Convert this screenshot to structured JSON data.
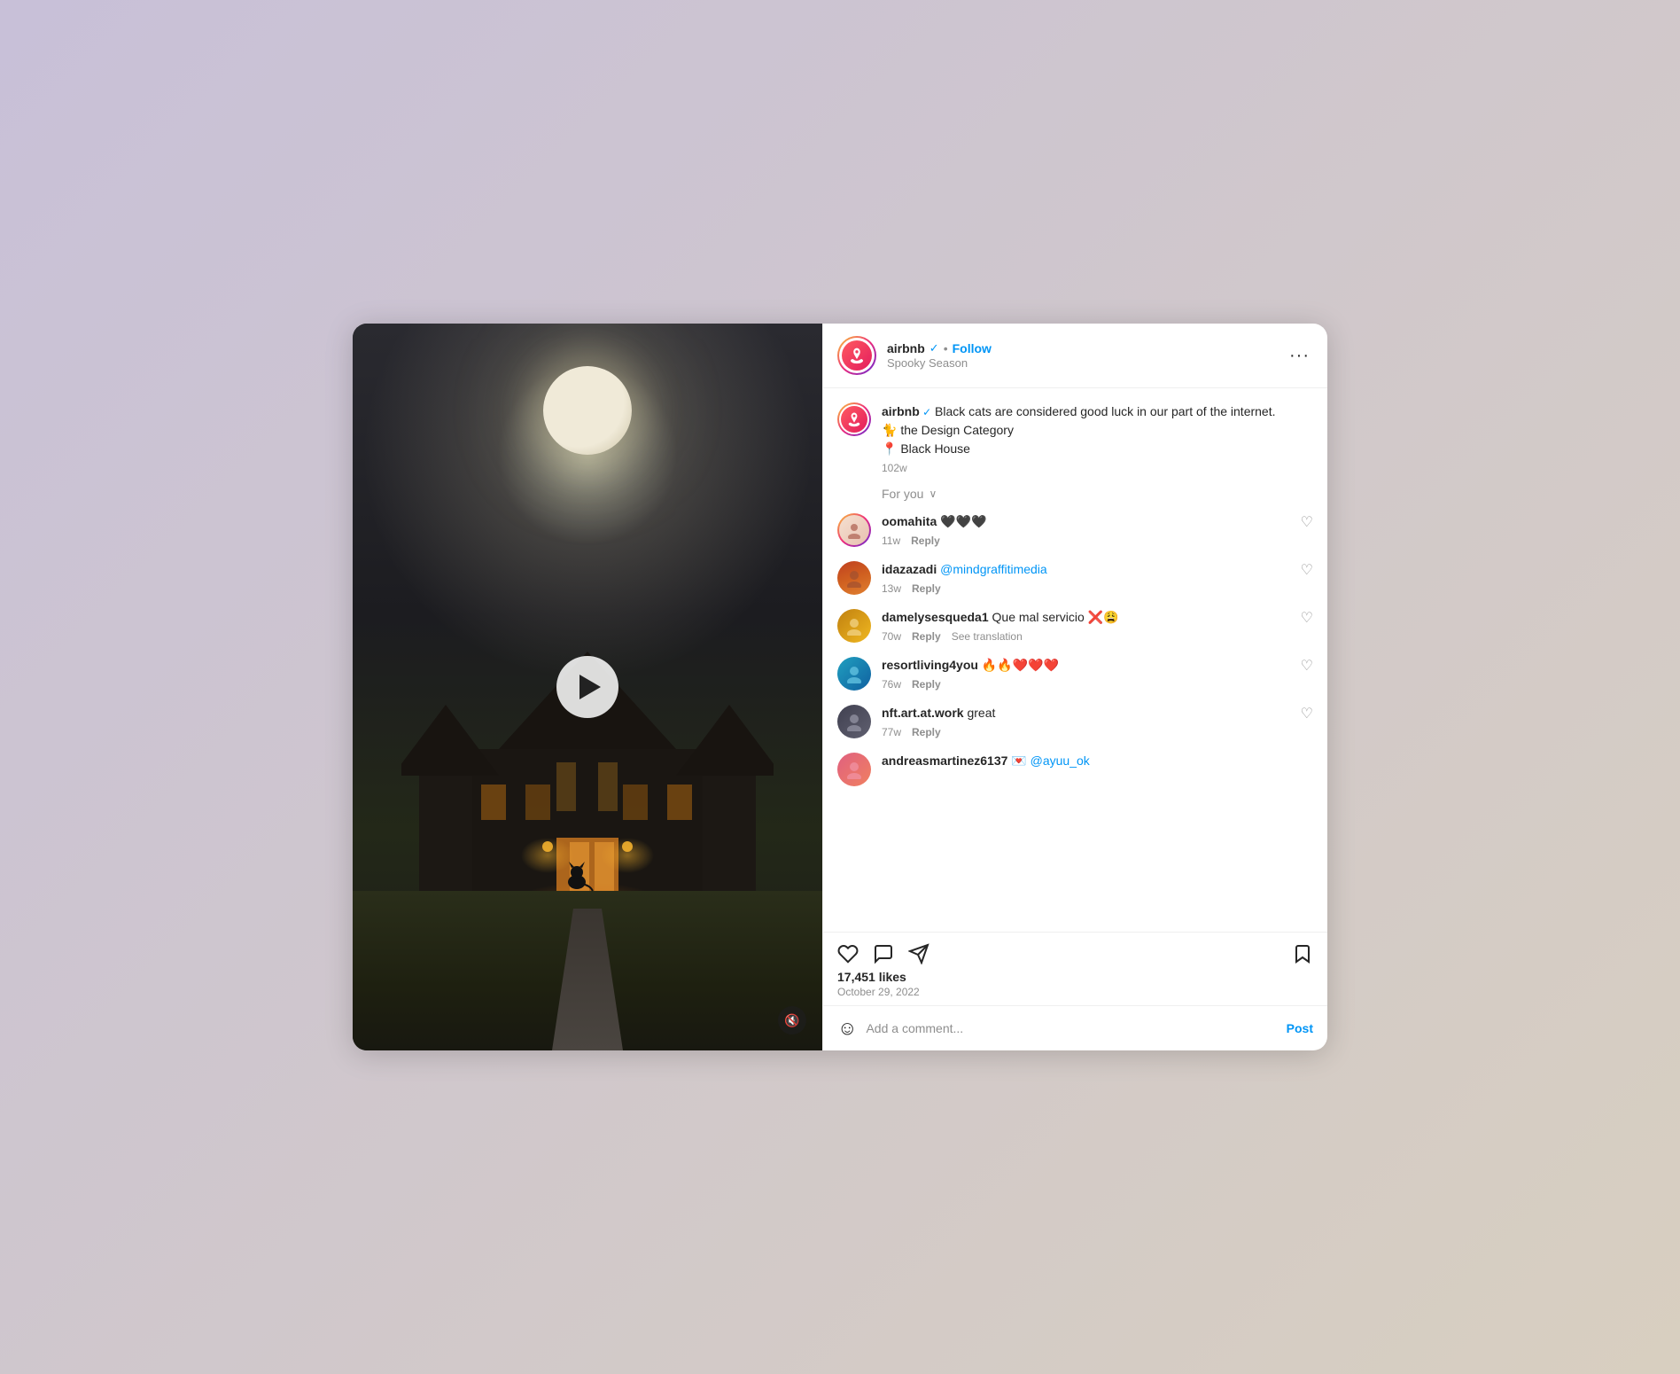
{
  "header": {
    "username": "airbnb",
    "verified": true,
    "verified_label": "✓",
    "dot": "•",
    "follow_label": "Follow",
    "subtitle": "Spooky Season",
    "more_icon": "•••"
  },
  "caption": {
    "username": "airbnb",
    "verified_label": "✓",
    "text": " Black cats are considered good luck in our part of the internet.",
    "line2": "🐈 the Design Category",
    "line3": "📍 Black House",
    "time": "102w"
  },
  "for_you": {
    "label": "For you",
    "chevron": "∨"
  },
  "comments": [
    {
      "username": "oomahita",
      "text": " 🖤🖤🖤",
      "time": "11w",
      "reply": "Reply",
      "avatar_class": "av-oomahita"
    },
    {
      "username": "idazazadi",
      "mention": "@mindgraffitimedia",
      "text": "",
      "time": "13w",
      "reply": "Reply",
      "avatar_class": "av-idazazi"
    },
    {
      "username": "damelysesqueda1",
      "text": " Que mal servicio ❌😩",
      "time": "70w",
      "reply": "Reply",
      "see_translation": "See translation",
      "avatar_class": "av-damely"
    },
    {
      "username": "resortliving4you",
      "text": " 🔥🔥❤️❤️❤️",
      "time": "76w",
      "reply": "Reply",
      "avatar_class": "av-resort"
    },
    {
      "username": "nft.art.at.work",
      "text": " great",
      "time": "77w",
      "reply": "Reply",
      "avatar_class": "av-nft"
    },
    {
      "username": "andreasmartinez6137",
      "text": " 💌 @ayuu_ok",
      "time": "",
      "reply": "",
      "avatar_class": "av-andrea",
      "partial": true
    }
  ],
  "actions": {
    "likes": "17,451 likes",
    "date": "October 29, 2022"
  },
  "add_comment": {
    "placeholder": "Add a comment...",
    "post_label": "Post"
  },
  "media": {
    "play_label": "Play",
    "mute_label": "🔇"
  }
}
